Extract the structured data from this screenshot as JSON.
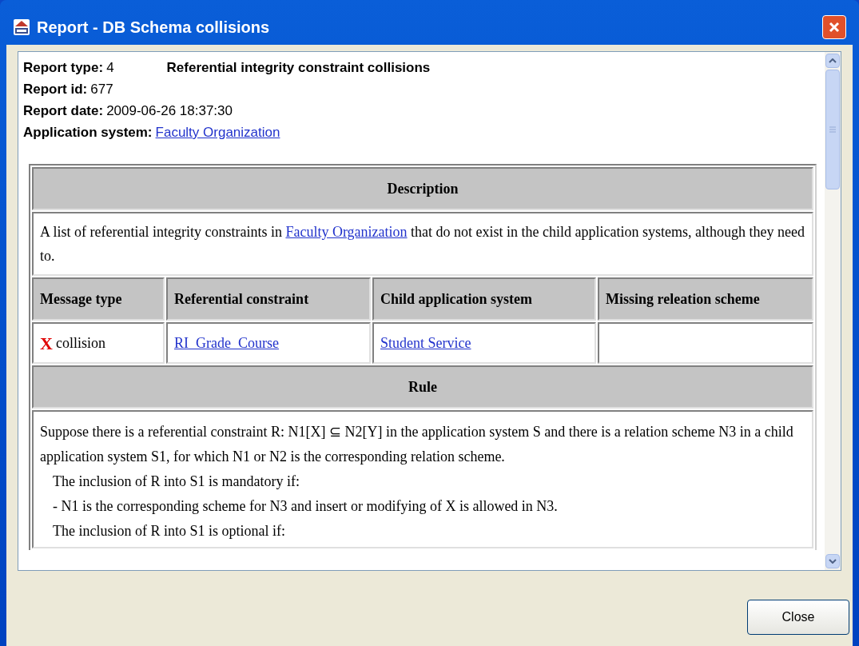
{
  "window": {
    "title": "Report - DB Schema collisions"
  },
  "header": [
    {
      "label": "Report type:",
      "value": "4",
      "extra": "Referential integrity constraint collisions"
    },
    {
      "label": "Report id:",
      "value": "677"
    },
    {
      "label": "Report date:",
      "value": "2009-06-26 18:37:30"
    },
    {
      "label": "Application system:",
      "link": "Faculty Organization"
    }
  ],
  "description": {
    "heading": "Description",
    "before": "A list of referential integrity constraints in ",
    "link": "Faculty Organization",
    "after": " that do not exist in the child application systems, although they need to."
  },
  "table": {
    "columns": [
      "Message type",
      "Referential constraint",
      "Child application system",
      "Missing releation scheme"
    ],
    "rows": [
      {
        "mark": "X",
        "type": "collision",
        "constraint": "RI_Grade_Course",
        "child": "Student Service",
        "missing": ""
      }
    ]
  },
  "rule": {
    "heading": "Rule",
    "lines": [
      {
        "kind": "para",
        "text": "Suppose there is a referential constraint R: N1[X] ⊆ N2[Y] in the application system S and there is a relation scheme N3 in a child application system S1, for which N1 or N2 is the corresponding relation scheme."
      },
      {
        "kind": "indent",
        "text": "The inclusion of R into S1 is mandatory if:"
      },
      {
        "kind": "indent",
        "text": "- N1 is the corresponding scheme for N3 and insert or modifying of X is allowed in N3."
      },
      {
        "kind": "indent",
        "text": "The inclusion of R into S1 is optional if:"
      }
    ]
  },
  "buttons": [
    "Close"
  ]
}
